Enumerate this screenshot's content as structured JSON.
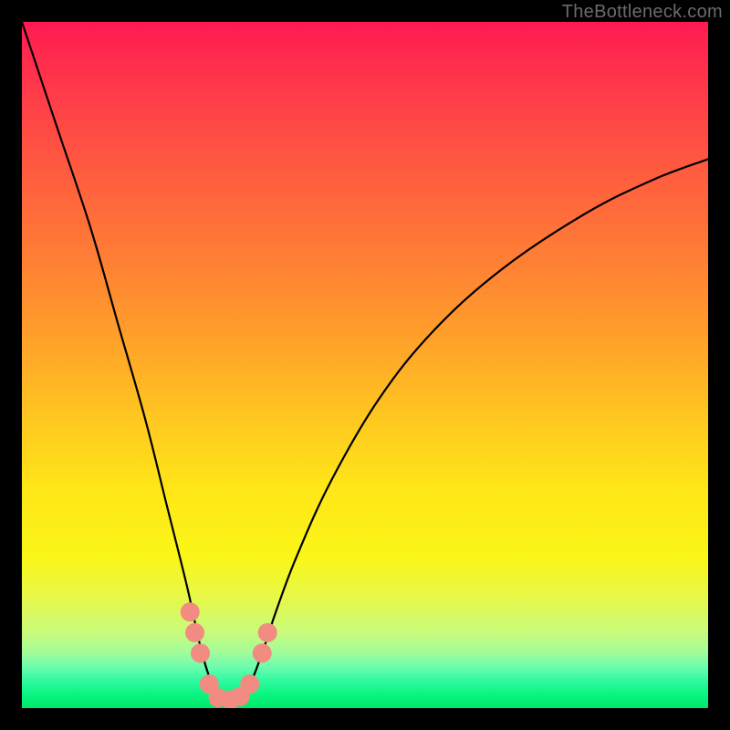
{
  "watermark": "TheBottleneck.com",
  "chart_data": {
    "type": "line",
    "title": "",
    "xlabel": "",
    "ylabel": "",
    "xlim": [
      0,
      100
    ],
    "ylim": [
      0,
      100
    ],
    "series": [
      {
        "name": "bottleneck-curve",
        "x": [
          0,
          5,
          10,
          14,
          18,
          21,
          24,
          26,
          27.5,
          29,
          31,
          33,
          35,
          37,
          40,
          45,
          52,
          60,
          70,
          82,
          92,
          100
        ],
        "values": [
          100,
          85,
          70,
          56,
          42,
          30,
          18,
          9,
          4,
          1,
          1,
          3,
          8,
          14,
          22,
          33,
          45,
          55,
          64,
          72,
          77,
          80
        ]
      }
    ],
    "markers": {
      "name": "highlight-dots",
      "color": "#f28b82",
      "points": [
        {
          "x": 24.5,
          "y": 14
        },
        {
          "x": 25.2,
          "y": 11
        },
        {
          "x": 26.0,
          "y": 8
        },
        {
          "x": 27.3,
          "y": 3.5
        },
        {
          "x": 28.6,
          "y": 1.5
        },
        {
          "x": 30.4,
          "y": 1.2
        },
        {
          "x": 31.8,
          "y": 1.7
        },
        {
          "x": 33.2,
          "y": 3.5
        },
        {
          "x": 35.0,
          "y": 8
        },
        {
          "x": 35.8,
          "y": 11
        }
      ]
    }
  }
}
